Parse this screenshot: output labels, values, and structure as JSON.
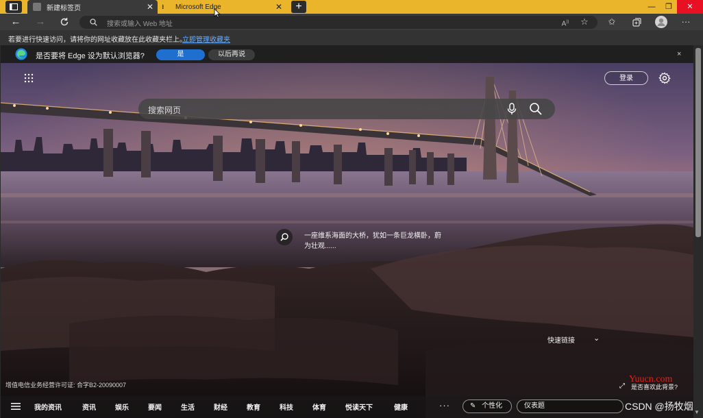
{
  "tabs": [
    {
      "title": "新建标签页",
      "active": true
    },
    {
      "title": "Microsoft Edge",
      "active": false
    }
  ],
  "window_controls": {
    "minimize": "—",
    "restore": "❐",
    "close": "✕"
  },
  "address_bar": {
    "placeholder": "搜索或输入 Web 地址"
  },
  "favorites_hint": {
    "text": "若要进行快速访问，请将你的网址收藏放在此收藏夹栏上。",
    "link": "立即管理收藏夹"
  },
  "infobar": {
    "text": "是否要将 Edge 设为默认浏览器?",
    "yes": "是",
    "later": "以后再说",
    "close": "×"
  },
  "newtab": {
    "login": "登录",
    "search_placeholder": "搜索网页",
    "image_caption": "一座维系海面的大桥，犹如一条巨龙横卧，蔚为壮观......",
    "quick_links": "快速链接",
    "license": "增值电信业务经营许可证: 合字B2-20090007",
    "like_background": "是否喜欢此背景?"
  },
  "bottom_nav": {
    "items": [
      "我的资讯",
      "资讯",
      "娱乐",
      "要闻",
      "生活",
      "财经",
      "教育",
      "科技",
      "体育",
      "悦读天下",
      "健康"
    ],
    "more": "···",
    "personalize": "个性化",
    "dashboard": "仪表题"
  },
  "watermarks": {
    "site": "Yuucn.com",
    "csdn": "CSDN @扬牧烟"
  },
  "colors": {
    "tabbar": "#eab42b",
    "accent": "#1f6fd1",
    "close_red": "#e81123"
  }
}
